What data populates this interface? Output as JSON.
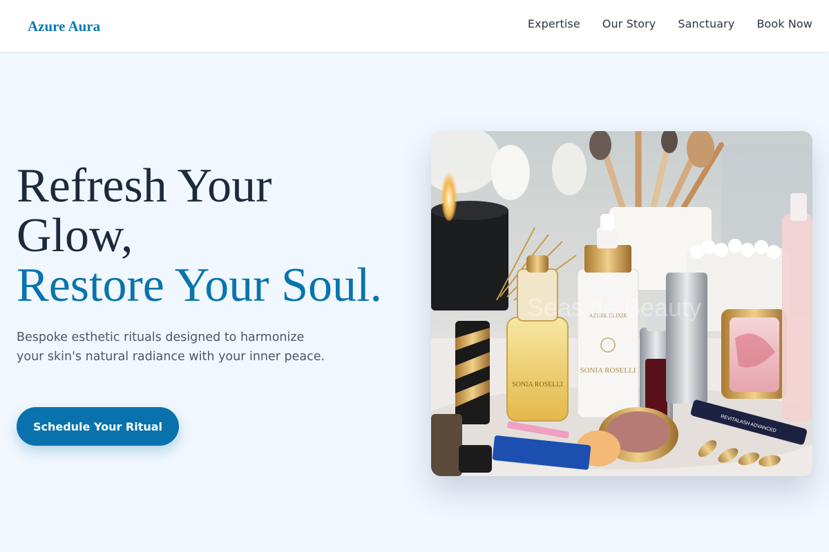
{
  "brand": {
    "name": "Azure Aura"
  },
  "nav": {
    "items": [
      "Expertise",
      "Our Story",
      "Sanctuary",
      "Book Now"
    ]
  },
  "hero": {
    "title_line1": "Refresh Your",
    "title_line2": "Glow,",
    "title_accent": "Restore Your Soul.",
    "subtitle": "Bespoke esthetic rituals designed to harmonize your skin's natural radiance with your inner peace.",
    "cta_label": "Schedule Your Ritual"
  },
  "image": {
    "watermark": "Seaside Beauty",
    "labels": {
      "bottle_left": "SONIA ROSELLI",
      "bottle_center_top": "AZURE ELIXIR",
      "bottle_center": "SONIA ROSELLI",
      "lash_serum": "REVITALASH ADVANCED"
    }
  },
  "colors": {
    "accent": "#0974ad",
    "brand": "#0b79b0",
    "heading": "#1d2a3c",
    "background": "#f0f7fe"
  }
}
